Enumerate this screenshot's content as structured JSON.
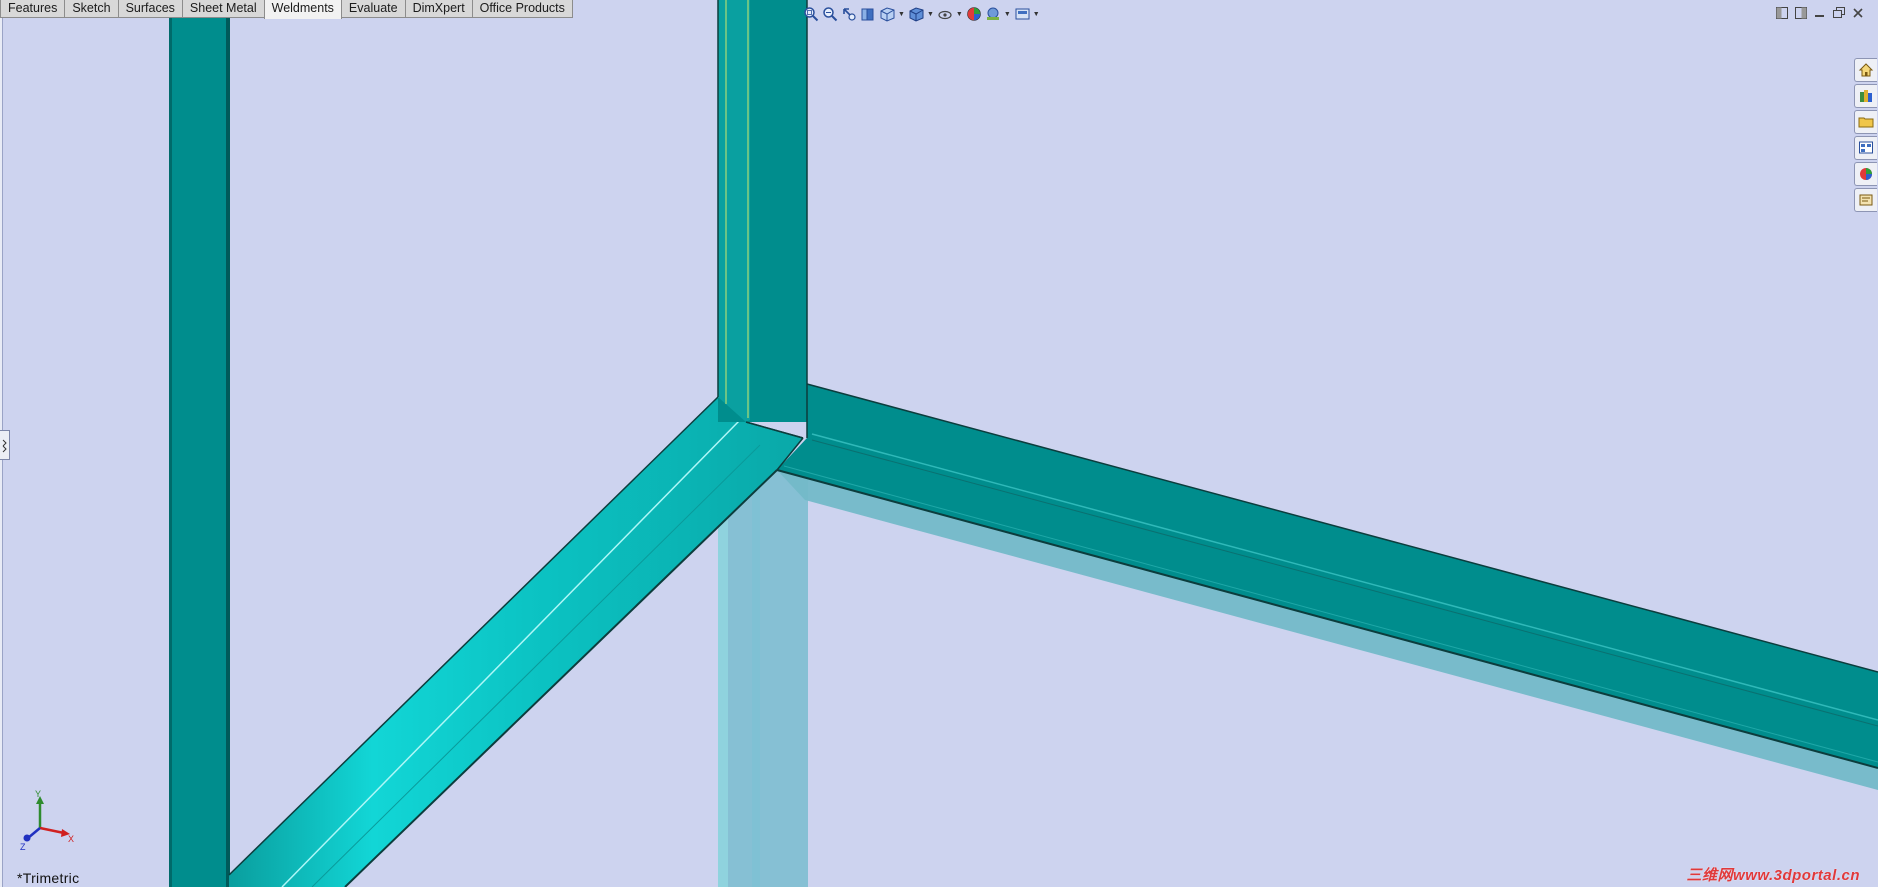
{
  "command_manager": {
    "tabs": [
      {
        "label": "Features",
        "active": false
      },
      {
        "label": "Sketch",
        "active": false
      },
      {
        "label": "Surfaces",
        "active": false
      },
      {
        "label": "Sheet Metal",
        "active": false
      },
      {
        "label": "Weldments",
        "active": true
      },
      {
        "label": "Evaluate",
        "active": false
      },
      {
        "label": "DimXpert",
        "active": false
      },
      {
        "label": "Office Products",
        "active": false
      }
    ]
  },
  "heads_up_toolbar": {
    "icons": [
      "zoom-to-fit-icon",
      "zoom-to-area-icon",
      "previous-view-icon",
      "section-view-icon",
      "view-orientation-icon",
      "display-style-icon",
      "hide-show-items-icon",
      "edit-appearance-icon",
      "apply-scene-icon",
      "view-settings-icon"
    ]
  },
  "window_controls": {
    "icons": [
      "tile-left-icon",
      "tile-right-icon",
      "minimize-icon",
      "restore-icon",
      "close-icon"
    ]
  },
  "task_pane": {
    "icons": [
      "resources-home-icon",
      "design-library-icon",
      "file-explorer-icon",
      "view-palette-icon",
      "appearances-scenes-icon",
      "custom-properties-icon"
    ]
  },
  "viewport": {
    "view_orientation": "*Trimetric",
    "triad": {
      "x": "X",
      "y": "Y",
      "z": "Z"
    },
    "colors": {
      "background": "#cdd3ef",
      "member_dark": "#008d8d",
      "member_light": "#0fd3d3",
      "member_ghost": "#7bc6d6"
    }
  },
  "watermark": "三维网www.3dportal.cn"
}
